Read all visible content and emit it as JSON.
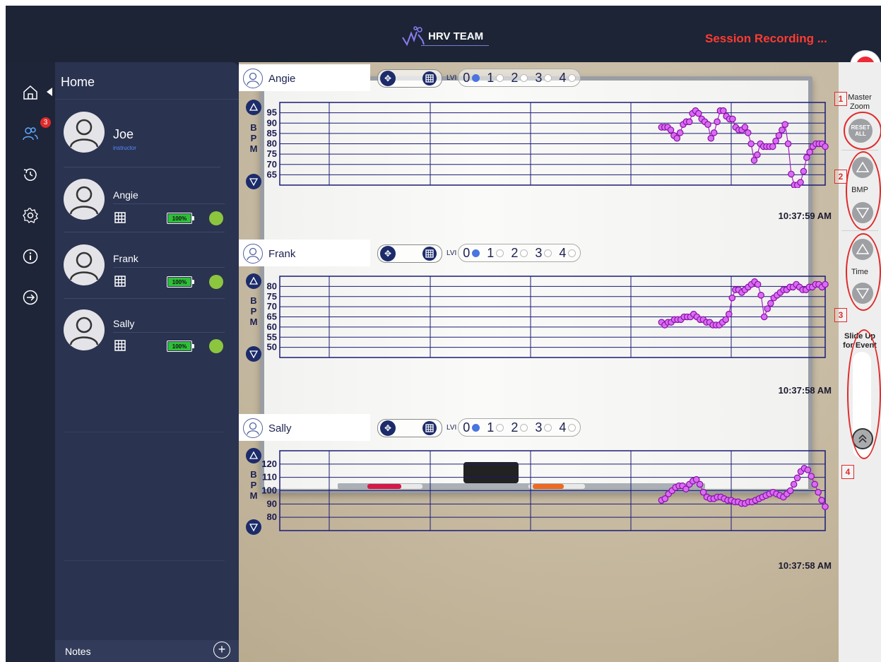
{
  "header": {
    "logo_text": "HRV TEAM",
    "status": "Session Recording ...",
    "status_color": "#ff3b30",
    "record_icon": "record-icon"
  },
  "nav": {
    "items": [
      {
        "name": "home-icon",
        "active": true
      },
      {
        "name": "users-icon",
        "badge": "3"
      },
      {
        "name": "history-icon"
      },
      {
        "name": "settings-icon"
      },
      {
        "name": "info-icon"
      },
      {
        "name": "logout-icon"
      }
    ]
  },
  "sidebar": {
    "title": "Home",
    "instructor": {
      "name": "Joe",
      "role": "instructor"
    },
    "participants": [
      {
        "name": "Angie",
        "battery": "100%"
      },
      {
        "name": "Frank",
        "battery": "100%"
      },
      {
        "name": "Sally",
        "battery": "100%"
      }
    ],
    "notes_label": "Notes",
    "notes_add_icon": "plus-circle-icon"
  },
  "panels": [
    {
      "name": "Angie",
      "lvi_label": "LVI",
      "lvi_options": [
        "0",
        "1",
        "2",
        "3",
        "4"
      ],
      "lvi_selected": 0,
      "axis_label": "BPM",
      "timestamp": "10:37:59 AM",
      "chart_data": {
        "type": "line",
        "ylabel": "BPM",
        "yticks": [
          95,
          90,
          85,
          80,
          75,
          70,
          65
        ],
        "ylim": [
          65,
          95
        ],
        "x_start": 0.7,
        "x_end": 1.0,
        "values": [
          86,
          86,
          86,
          85,
          83,
          82,
          84,
          87,
          88,
          88,
          91,
          92,
          91,
          89,
          88,
          87,
          82,
          84,
          88,
          92,
          92,
          90,
          89,
          89,
          86,
          85,
          85,
          86,
          84,
          80,
          74,
          76,
          80,
          79,
          79,
          79,
          79,
          81,
          83,
          85,
          87,
          80,
          69,
          65,
          65,
          66,
          70,
          75,
          77,
          79,
          80,
          80,
          80,
          79
        ]
      }
    },
    {
      "name": "Frank",
      "lvi_label": "LVI",
      "lvi_options": [
        "0",
        "1",
        "2",
        "3",
        "4"
      ],
      "lvi_selected": 0,
      "axis_label": "BPM",
      "timestamp": "10:37:58 AM",
      "chart_data": {
        "type": "line",
        "ylabel": "BPM",
        "yticks": [
          80,
          75,
          70,
          65,
          60,
          55,
          50
        ],
        "ylim": [
          50,
          80
        ],
        "x_start": 0.7,
        "x_end": 1.0,
        "values": [
          63,
          62,
          63,
          63,
          64,
          64,
          64,
          65,
          65,
          65,
          66,
          65,
          64,
          64,
          63,
          63,
          62,
          62,
          62,
          63,
          64,
          66,
          72,
          75,
          75,
          74,
          75,
          76,
          77,
          78,
          77,
          73,
          65,
          68,
          70,
          72,
          73,
          74,
          75,
          75,
          76,
          76,
          77,
          76,
          75,
          75,
          76,
          76,
          77,
          77,
          76,
          77
        ]
      }
    },
    {
      "name": "Sally",
      "lvi_label": "LVI",
      "lvi_options": [
        "0",
        "1",
        "2",
        "3",
        "4"
      ],
      "lvi_selected": 0,
      "axis_label": "BPM",
      "timestamp": "10:37:58 AM",
      "chart_data": {
        "type": "line",
        "ylabel": "BPM",
        "yticks": [
          120,
          110,
          100,
          90,
          80
        ],
        "ylim": [
          75,
          125
        ],
        "x_start": 0.7,
        "x_end": 1.0,
        "values": [
          94,
          95,
          98,
          100,
          102,
          103,
          103,
          101,
          104,
          106,
          107,
          104,
          99,
          96,
          95,
          95,
          96,
          96,
          95,
          94,
          94,
          93,
          93,
          92,
          92,
          93,
          93,
          94,
          95,
          96,
          97,
          98,
          99,
          98,
          97,
          96,
          98,
          100,
          104,
          108,
          112,
          114,
          113,
          109,
          104,
          99,
          94,
          90
        ]
      }
    }
  ],
  "right_panel": {
    "master_zoom_label": "Master Zoom",
    "reset_label": "RESET ALL",
    "bpm_label": "BMP",
    "time_label": "Time",
    "event_label": "Slide Up for Event",
    "annotations": [
      "1",
      "2",
      "3",
      "4"
    ],
    "annotation_color": "#e02a2a"
  }
}
